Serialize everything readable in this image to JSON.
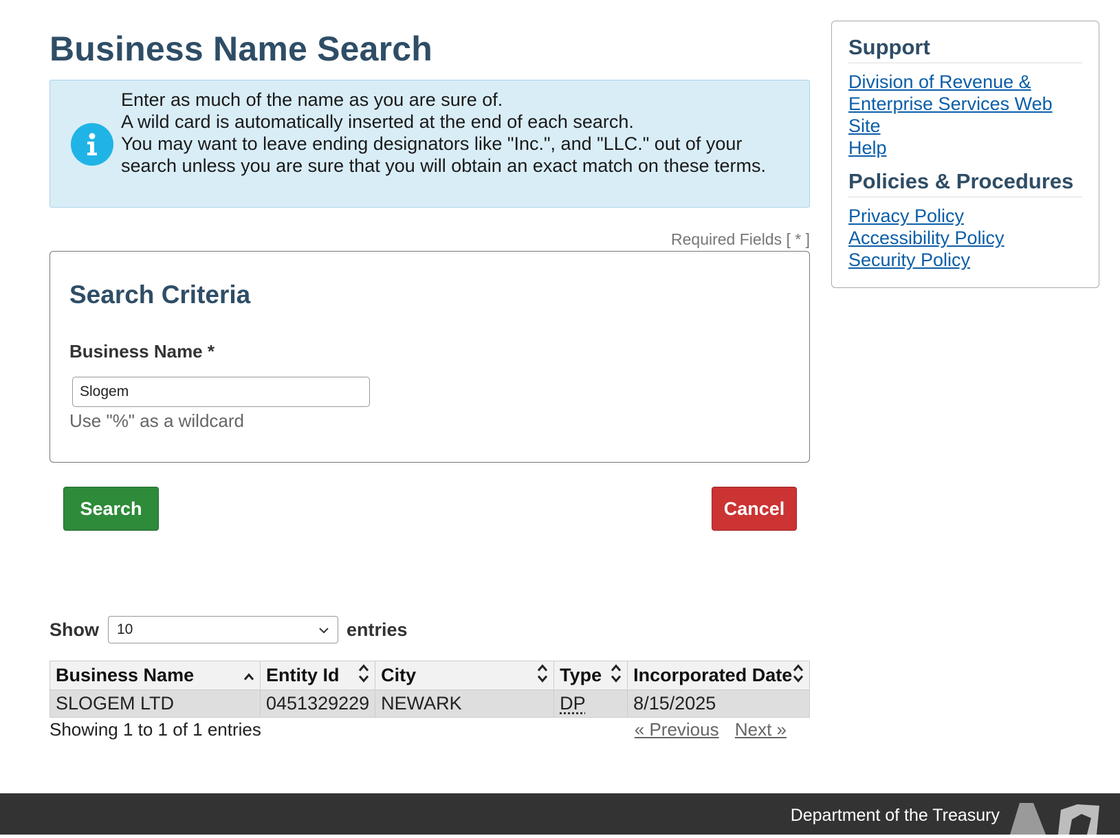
{
  "page": {
    "title": "Business Name Search"
  },
  "info": {
    "lines": [
      "Enter as much of the name as you are sure of.",
      "A wild card is automatically inserted at the end of each search.",
      "You may want to leave ending designators like \"Inc.\", and \"LLC.\" out of your search unless you are sure that you will obtain an exact match on these terms."
    ],
    "icon": "info-icon"
  },
  "form": {
    "required_note": "Required Fields [ * ]",
    "section_title": "Search Criteria",
    "business_name_label": "Business Name *",
    "business_name_value": "Slogem",
    "hint": "Use \"%\" as a wildcard",
    "search_label": "Search",
    "cancel_label": "Cancel"
  },
  "results": {
    "show_label": "Show",
    "entries_label": "entries",
    "page_length": "10",
    "columns": [
      "Business Name",
      "Entity Id",
      "City",
      "Type",
      "Incorporated Date"
    ],
    "rows": [
      {
        "business_name": "SLOGEM LTD",
        "entity_id": "0451329229",
        "city": "NEWARK",
        "type": "DP",
        "incorporated_date": "8/15/2025"
      }
    ],
    "info": "Showing 1 to 1 of 1 entries",
    "previous_label": "« Previous",
    "next_label": "Next »"
  },
  "sidebar": {
    "support_heading": "Support",
    "support_links": [
      "Division of Revenue & Enterprise Services Web Site",
      "Help"
    ],
    "policies_heading": "Policies & Procedures",
    "policy_links": [
      "Privacy Policy",
      "Accessibility Policy",
      "Security Policy"
    ]
  },
  "footer": {
    "text": "Department of the Treasury"
  },
  "colors": {
    "heading": "#2f4d66",
    "info_bg": "#d9edf7",
    "search_button": "#2e8b3a",
    "cancel_button": "#cc3333",
    "link": "#0b5ea8",
    "footer_bg": "#333333"
  }
}
